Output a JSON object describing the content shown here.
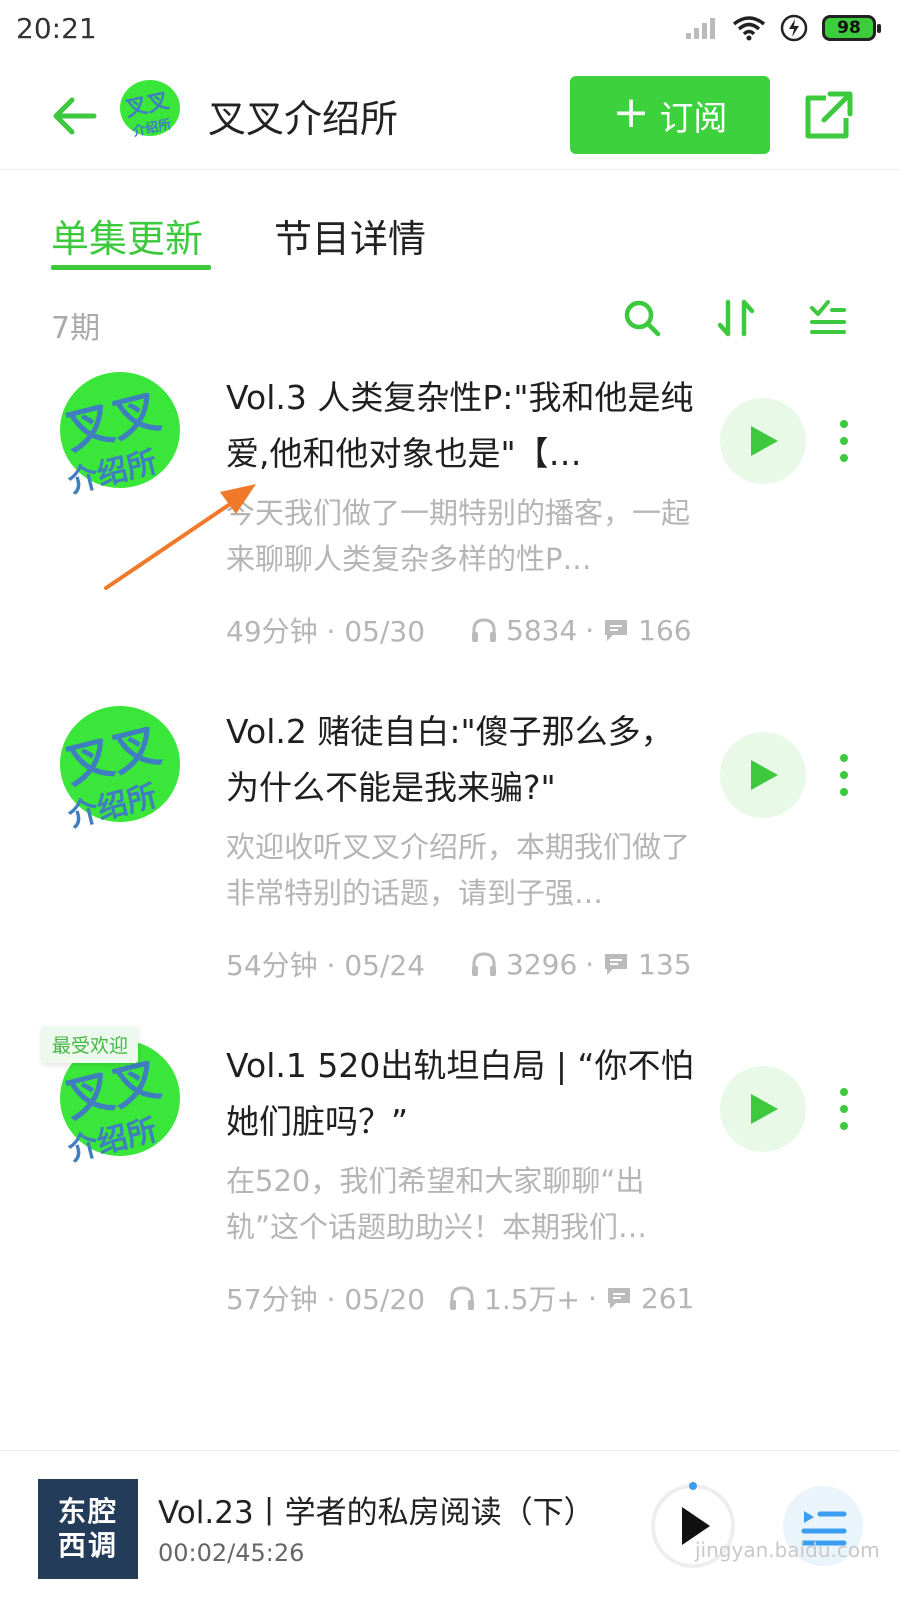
{
  "status_bar": {
    "time": "20:21",
    "battery": "98"
  },
  "header": {
    "title": "叉叉介绍所",
    "logo_text_top": "叉叉",
    "logo_text_bottom": "介绍所",
    "subscribe_label": "订阅",
    "icons": {
      "back": "arrow-left-icon",
      "share": "external-link-icon"
    }
  },
  "tabs": [
    {
      "label": "单集更新",
      "active": true
    },
    {
      "label": "节目详情",
      "active": false
    }
  ],
  "toolbar": {
    "episode_count": "7期",
    "icons": [
      "search-icon",
      "sort-icon",
      "filter-list-icon"
    ]
  },
  "episodes": [
    {
      "title": "Vol.3 人类复杂性P:\"我和他是纯爱,他和他对象也是\"【…",
      "description": "今天我们做了一期特别的播客，一起来聊聊人类复杂多样的性P…",
      "duration_date": "49分钟 · 05/30",
      "plays": "5834",
      "comments": "166",
      "badge": ""
    },
    {
      "title": "Vol.2 赌徒自白:\"傻子那么多，为什么不能是我来骗?\"",
      "description": "欢迎收听叉叉介绍所，本期我们做了非常特别的话题，请到子强…",
      "duration_date": "54分钟 · 05/24",
      "plays": "3296",
      "comments": "135",
      "badge": ""
    },
    {
      "title": "Vol.1 520出轨坦白局 | “你不怕她们脏吗？”",
      "description": "在520，我们希望和大家聊聊“出轨”这个话题助助兴！本期我们…",
      "duration_date": "57分钟 · 05/20",
      "plays": "1.5万+",
      "comments": "261",
      "badge": "最受欢迎"
    }
  ],
  "player": {
    "cover_line1": "东腔",
    "cover_line2": "西调",
    "title": "Vol.23丨学者的私房阅读（下）",
    "time": "00:02/45:26"
  },
  "watermark": "jingyan.baidu.com",
  "colors": {
    "accent": "#3dd13d",
    "tab_active": "#3dc93d",
    "annotation_arrow": "#f07a2a",
    "cover_blue": "#3f7fc0"
  }
}
